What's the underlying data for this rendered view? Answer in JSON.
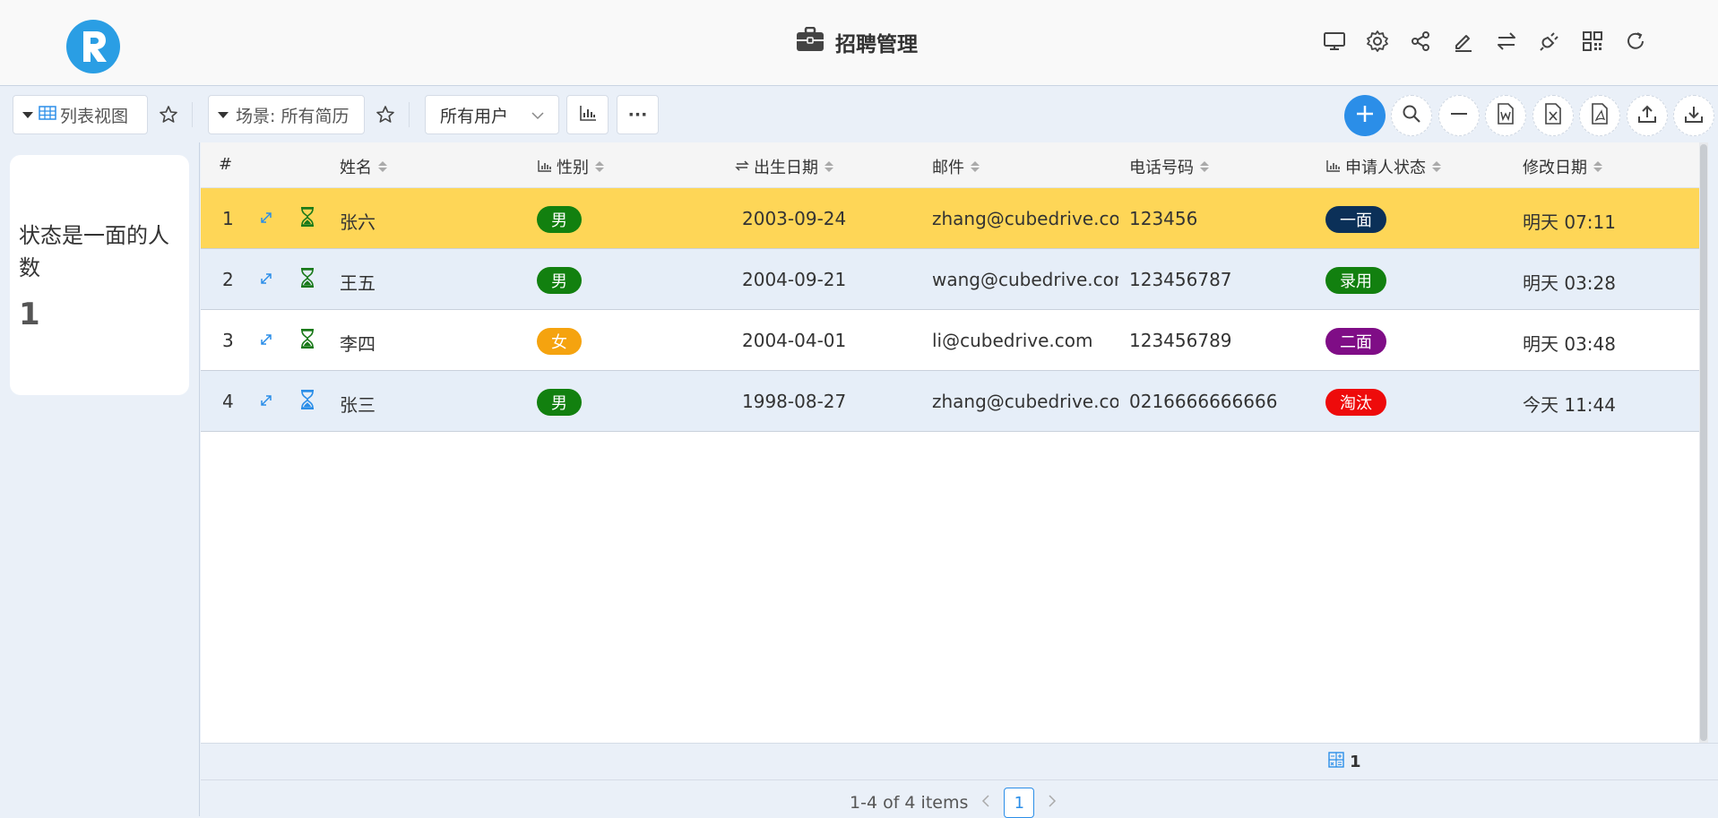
{
  "app": {
    "title": "招聘管理",
    "brand_color": "#2a9ee4",
    "header_icons": [
      "desktop-icon",
      "gear-icon",
      "share-icon",
      "edit-icon",
      "swap-icon",
      "plugin-icon",
      "qr-code-icon",
      "refresh-icon"
    ]
  },
  "toolbar": {
    "view_label": "列表视图",
    "scene_label": "场景: 所有简历",
    "user_select_value": "所有用户",
    "more_label": "···",
    "right_buttons": [
      "add-icon",
      "search-icon",
      "minus-icon",
      "word-export-icon",
      "excel-export-icon",
      "pdf-export-icon",
      "upload-icon",
      "download-icon"
    ]
  },
  "sidebar": {
    "card_title": "状态是一面的人数",
    "card_value": "1"
  },
  "table": {
    "columns": {
      "index": "#",
      "name": "姓名",
      "gender": "性别",
      "birth": "出生日期",
      "email": "邮件",
      "phone": "电话号码",
      "status": "申请人状态",
      "modified": "修改日期"
    },
    "rows": [
      {
        "index": "1",
        "name": "张六",
        "gender": "男",
        "gender_color": "#12800f",
        "birth": "2003-09-24",
        "email": "zhang@cubedrive.com",
        "phone": "123456",
        "status": "一面",
        "status_color": "#0b3058",
        "modified": "明天 07:11",
        "row_bg": "#fed657",
        "icon_color": "#1a7a1a"
      },
      {
        "index": "2",
        "name": "王五",
        "gender": "男",
        "gender_color": "#12800f",
        "birth": "2004-09-21",
        "email": "wang@cubedrive.com",
        "phone": "123456787",
        "status": "录用",
        "status_color": "#12800f",
        "modified": "明天 03:28",
        "row_bg": "#e6eef8",
        "icon_color": "#1a7a1a"
      },
      {
        "index": "3",
        "name": "李四",
        "gender": "女",
        "gender_color": "#f5a30f",
        "birth": "2004-04-01",
        "email": "li@cubedrive.com",
        "phone": "123456789",
        "status": "二面",
        "status_color": "#7f0d86",
        "modified": "明天 03:48",
        "row_bg": "#ffffff",
        "icon_color": "#1a7a1a"
      },
      {
        "index": "4",
        "name": "张三",
        "gender": "男",
        "gender_color": "#12800f",
        "birth": "1998-08-27",
        "email": "zhang@cubedrive.com",
        "phone": "0216666666666",
        "status": "淘汰",
        "status_color": "#ee0b0b",
        "modified": "今天 11:44",
        "row_bg": "#e6eef8",
        "icon_color": "#2b8ee8"
      }
    ]
  },
  "summary": {
    "count": "1"
  },
  "pager": {
    "range_text": "1-4 of 4 items",
    "current_page": "1"
  }
}
